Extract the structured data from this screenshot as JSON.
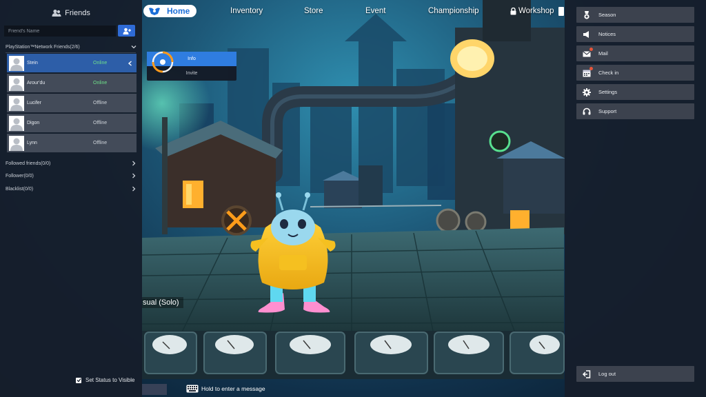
{
  "nav": {
    "home": "Home",
    "inventory": "Inventory",
    "store": "Store",
    "event": "Event",
    "championship": "Championship",
    "workshop": "Workshop"
  },
  "friends": {
    "title": "Friends",
    "search_placeholder": "Friend's Name",
    "psn_group": "PlayStation™Network Friends(2/6)",
    "list": [
      {
        "name": "Stein",
        "status": "Online",
        "online": true
      },
      {
        "name": "Arour'du",
        "status": "Online",
        "online": true
      },
      {
        "name": "Lucifer",
        "status": "Offline",
        "online": false
      },
      {
        "name": "Digon",
        "status": "Offline",
        "online": false
      },
      {
        "name": "Lynn",
        "status": "Offline",
        "online": false
      }
    ],
    "followed": "Followed friends(0/0)",
    "follower": "Follower(0/0)",
    "blacklist": "Blacklist(0/0)",
    "visible_label": "Set Status to Visible"
  },
  "popup": {
    "info": "Info",
    "invite": "Invite"
  },
  "game": {
    "mode_label": "sual (Solo)"
  },
  "chat": {
    "hint": "Hold to enter a message"
  },
  "menu": {
    "season": "Season",
    "notices": "Notices",
    "mail": "Mail",
    "check_in": "Check in",
    "settings": "Settings",
    "support": "Support",
    "logout": "Log out"
  },
  "colors": {
    "accent_blue": "#2f7de0",
    "online_green": "#6fe08a",
    "notification_red": "#e8553a",
    "panel_bg": "#161e2c"
  }
}
